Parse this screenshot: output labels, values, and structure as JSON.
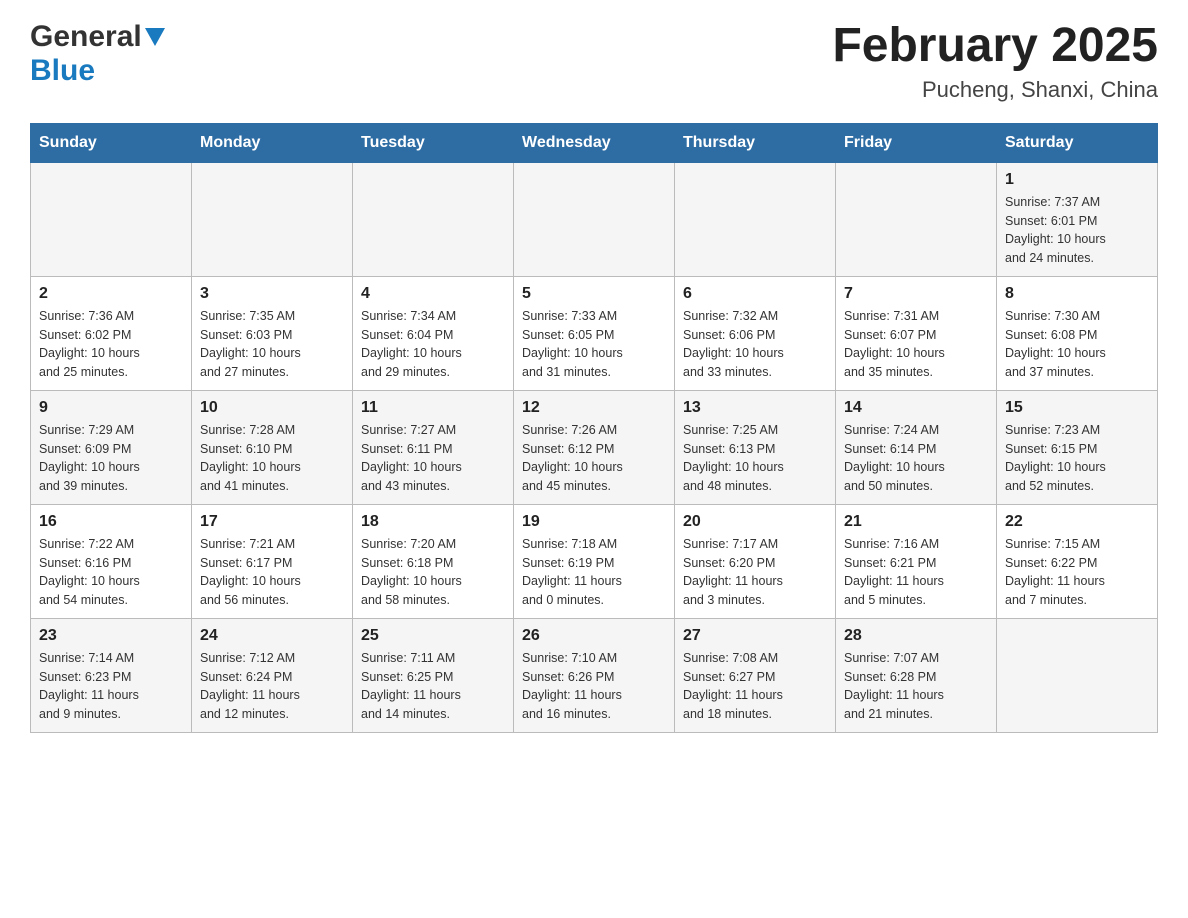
{
  "header": {
    "logo_general": "General",
    "logo_blue": "Blue",
    "month_title": "February 2025",
    "location": "Pucheng, Shanxi, China"
  },
  "days_of_week": [
    "Sunday",
    "Monday",
    "Tuesday",
    "Wednesday",
    "Thursday",
    "Friday",
    "Saturday"
  ],
  "weeks": [
    [
      {
        "day": "",
        "info": ""
      },
      {
        "day": "",
        "info": ""
      },
      {
        "day": "",
        "info": ""
      },
      {
        "day": "",
        "info": ""
      },
      {
        "day": "",
        "info": ""
      },
      {
        "day": "",
        "info": ""
      },
      {
        "day": "1",
        "info": "Sunrise: 7:37 AM\nSunset: 6:01 PM\nDaylight: 10 hours\nand 24 minutes."
      }
    ],
    [
      {
        "day": "2",
        "info": "Sunrise: 7:36 AM\nSunset: 6:02 PM\nDaylight: 10 hours\nand 25 minutes."
      },
      {
        "day": "3",
        "info": "Sunrise: 7:35 AM\nSunset: 6:03 PM\nDaylight: 10 hours\nand 27 minutes."
      },
      {
        "day": "4",
        "info": "Sunrise: 7:34 AM\nSunset: 6:04 PM\nDaylight: 10 hours\nand 29 minutes."
      },
      {
        "day": "5",
        "info": "Sunrise: 7:33 AM\nSunset: 6:05 PM\nDaylight: 10 hours\nand 31 minutes."
      },
      {
        "day": "6",
        "info": "Sunrise: 7:32 AM\nSunset: 6:06 PM\nDaylight: 10 hours\nand 33 minutes."
      },
      {
        "day": "7",
        "info": "Sunrise: 7:31 AM\nSunset: 6:07 PM\nDaylight: 10 hours\nand 35 minutes."
      },
      {
        "day": "8",
        "info": "Sunrise: 7:30 AM\nSunset: 6:08 PM\nDaylight: 10 hours\nand 37 minutes."
      }
    ],
    [
      {
        "day": "9",
        "info": "Sunrise: 7:29 AM\nSunset: 6:09 PM\nDaylight: 10 hours\nand 39 minutes."
      },
      {
        "day": "10",
        "info": "Sunrise: 7:28 AM\nSunset: 6:10 PM\nDaylight: 10 hours\nand 41 minutes."
      },
      {
        "day": "11",
        "info": "Sunrise: 7:27 AM\nSunset: 6:11 PM\nDaylight: 10 hours\nand 43 minutes."
      },
      {
        "day": "12",
        "info": "Sunrise: 7:26 AM\nSunset: 6:12 PM\nDaylight: 10 hours\nand 45 minutes."
      },
      {
        "day": "13",
        "info": "Sunrise: 7:25 AM\nSunset: 6:13 PM\nDaylight: 10 hours\nand 48 minutes."
      },
      {
        "day": "14",
        "info": "Sunrise: 7:24 AM\nSunset: 6:14 PM\nDaylight: 10 hours\nand 50 minutes."
      },
      {
        "day": "15",
        "info": "Sunrise: 7:23 AM\nSunset: 6:15 PM\nDaylight: 10 hours\nand 52 minutes."
      }
    ],
    [
      {
        "day": "16",
        "info": "Sunrise: 7:22 AM\nSunset: 6:16 PM\nDaylight: 10 hours\nand 54 minutes."
      },
      {
        "day": "17",
        "info": "Sunrise: 7:21 AM\nSunset: 6:17 PM\nDaylight: 10 hours\nand 56 minutes."
      },
      {
        "day": "18",
        "info": "Sunrise: 7:20 AM\nSunset: 6:18 PM\nDaylight: 10 hours\nand 58 minutes."
      },
      {
        "day": "19",
        "info": "Sunrise: 7:18 AM\nSunset: 6:19 PM\nDaylight: 11 hours\nand 0 minutes."
      },
      {
        "day": "20",
        "info": "Sunrise: 7:17 AM\nSunset: 6:20 PM\nDaylight: 11 hours\nand 3 minutes."
      },
      {
        "day": "21",
        "info": "Sunrise: 7:16 AM\nSunset: 6:21 PM\nDaylight: 11 hours\nand 5 minutes."
      },
      {
        "day": "22",
        "info": "Sunrise: 7:15 AM\nSunset: 6:22 PM\nDaylight: 11 hours\nand 7 minutes."
      }
    ],
    [
      {
        "day": "23",
        "info": "Sunrise: 7:14 AM\nSunset: 6:23 PM\nDaylight: 11 hours\nand 9 minutes."
      },
      {
        "day": "24",
        "info": "Sunrise: 7:12 AM\nSunset: 6:24 PM\nDaylight: 11 hours\nand 12 minutes."
      },
      {
        "day": "25",
        "info": "Sunrise: 7:11 AM\nSunset: 6:25 PM\nDaylight: 11 hours\nand 14 minutes."
      },
      {
        "day": "26",
        "info": "Sunrise: 7:10 AM\nSunset: 6:26 PM\nDaylight: 11 hours\nand 16 minutes."
      },
      {
        "day": "27",
        "info": "Sunrise: 7:08 AM\nSunset: 6:27 PM\nDaylight: 11 hours\nand 18 minutes."
      },
      {
        "day": "28",
        "info": "Sunrise: 7:07 AM\nSunset: 6:28 PM\nDaylight: 11 hours\nand 21 minutes."
      },
      {
        "day": "",
        "info": ""
      }
    ]
  ]
}
